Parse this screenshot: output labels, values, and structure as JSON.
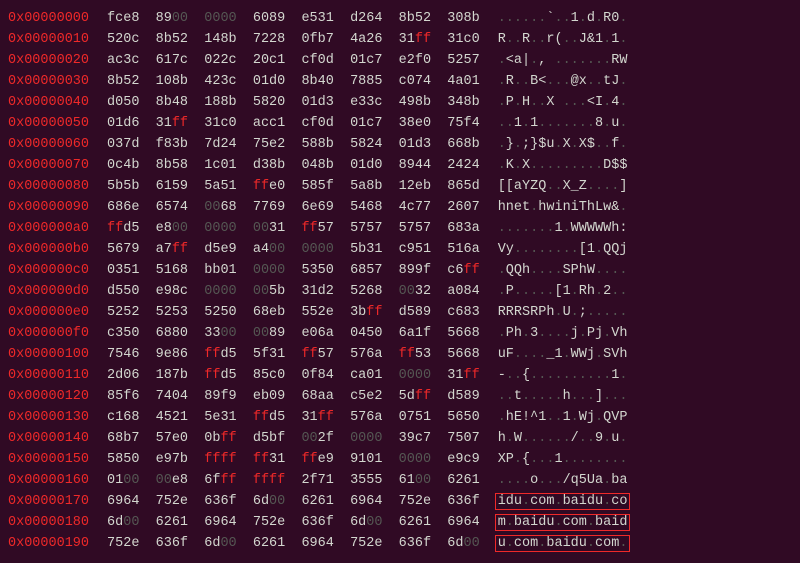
{
  "rows": [
    {
      "addr": "0x00000000",
      "hex": [
        "fce8",
        "8900",
        "0000",
        "6089",
        "e531",
        "d264",
        "8b52",
        "308b"
      ],
      "ascii": "......`..1.d.R0."
    },
    {
      "addr": "0x00000010",
      "hex": [
        "520c",
        "8b52",
        "148b",
        "7228",
        "0fb7",
        "4a26",
        "31ff",
        "31c0"
      ],
      "ascii": "R..R..r(..J&1.1."
    },
    {
      "addr": "0x00000020",
      "hex": [
        "ac3c",
        "617c",
        "022c",
        "20c1",
        "cf0d",
        "01c7",
        "e2f0",
        "5257"
      ],
      "ascii": ".<a|., .......RW"
    },
    {
      "addr": "0x00000030",
      "hex": [
        "8b52",
        "108b",
        "423c",
        "01d0",
        "8b40",
        "7885",
        "c074",
        "4a01"
      ],
      "ascii": ".R..B<...@x..tJ."
    },
    {
      "addr": "0x00000040",
      "hex": [
        "d050",
        "8b48",
        "188b",
        "5820",
        "01d3",
        "e33c",
        "498b",
        "348b"
      ],
      "ascii": ".P.H..X ...<I.4."
    },
    {
      "addr": "0x00000050",
      "hex": [
        "01d6",
        "31ff",
        "31c0",
        "acc1",
        "cf0d",
        "01c7",
        "38e0",
        "75f4"
      ],
      "ascii": "..1.1.......8.u."
    },
    {
      "addr": "0x00000060",
      "hex": [
        "037d",
        "f83b",
        "7d24",
        "75e2",
        "588b",
        "5824",
        "01d3",
        "668b"
      ],
      "ascii": ".}.;}$u.X.X$..f."
    },
    {
      "addr": "0x00000070",
      "hex": [
        "0c4b",
        "8b58",
        "1c01",
        "d38b",
        "048b",
        "01d0",
        "8944",
        "2424"
      ],
      "ascii": ".K.X.........D$$"
    },
    {
      "addr": "0x00000080",
      "hex": [
        "5b5b",
        "6159",
        "5a51",
        "ffe0",
        "585f",
        "5a8b",
        "12eb",
        "865d"
      ],
      "ascii": "[[aYZQ..X_Z....]"
    },
    {
      "addr": "0x00000090",
      "hex": [
        "686e",
        "6574",
        "0068",
        "7769",
        "6e69",
        "5468",
        "4c77",
        "2607"
      ],
      "ascii": "hnet.hwiniThLw&."
    },
    {
      "addr": "0x000000a0",
      "hex": [
        "ffd5",
        "e800",
        "0000",
        "0031",
        "ff57",
        "5757",
        "5757",
        "683a"
      ],
      "ascii": ".......1.WWWWWh:"
    },
    {
      "addr": "0x000000b0",
      "hex": [
        "5679",
        "a7ff",
        "d5e9",
        "a400",
        "0000",
        "5b31",
        "c951",
        "516a"
      ],
      "ascii": "Vy........[1.QQj"
    },
    {
      "addr": "0x000000c0",
      "hex": [
        "0351",
        "5168",
        "bb01",
        "0000",
        "5350",
        "6857",
        "899f",
        "c6ff"
      ],
      "ascii": ".QQh....SPhW...."
    },
    {
      "addr": "0x000000d0",
      "hex": [
        "d550",
        "e98c",
        "0000",
        "005b",
        "31d2",
        "5268",
        "0032",
        "a084"
      ],
      "ascii": ".P.....[1.Rh.2.."
    },
    {
      "addr": "0x000000e0",
      "hex": [
        "5252",
        "5253",
        "5250",
        "68eb",
        "552e",
        "3bff",
        "d589",
        "c683"
      ],
      "ascii": "RRRSRPh.U.;....."
    },
    {
      "addr": "0x000000f0",
      "hex": [
        "c350",
        "6880",
        "3300",
        "0089",
        "e06a",
        "0450",
        "6a1f",
        "5668"
      ],
      "ascii": ".Ph.3....j.Pj.Vh"
    },
    {
      "addr": "0x00000100",
      "hex": [
        "7546",
        "9e86",
        "ffd5",
        "5f31",
        "ff57",
        "576a",
        "ff53",
        "5668"
      ],
      "ascii": "uF...._1.WWj.SVh"
    },
    {
      "addr": "0x00000110",
      "hex": [
        "2d06",
        "187b",
        "ffd5",
        "85c0",
        "0f84",
        "ca01",
        "0000",
        "31ff"
      ],
      "ascii": "-..{..........1."
    },
    {
      "addr": "0x00000120",
      "hex": [
        "85f6",
        "7404",
        "89f9",
        "eb09",
        "68aa",
        "c5e2",
        "5dff",
        "d589"
      ],
      "ascii": "..t.....h...]..."
    },
    {
      "addr": "0x00000130",
      "hex": [
        "c168",
        "4521",
        "5e31",
        "ffd5",
        "31ff",
        "576a",
        "0751",
        "5650"
      ],
      "ascii": ".hE!^1..1.Wj.QVP"
    },
    {
      "addr": "0x00000140",
      "hex": [
        "68b7",
        "57e0",
        "0bff",
        "d5bf",
        "002f",
        "0000",
        "39c7",
        "7507"
      ],
      "ascii": "h.W....../..9.u."
    },
    {
      "addr": "0x00000150",
      "hex": [
        "5850",
        "e97b",
        "ffff",
        "ff31",
        "ffe9",
        "9101",
        "0000",
        "e9c9"
      ],
      "ascii": "XP.{...1........"
    },
    {
      "addr": "0x00000160",
      "hex": [
        "0100",
        "00e8",
        "6fff",
        "ffff",
        "2f71",
        "3555",
        "6100",
        "6261"
      ],
      "ascii": "....o.../q5Ua.ba"
    },
    {
      "addr": "0x00000170",
      "hex": [
        "6964",
        "752e",
        "636f",
        "6d00",
        "6261",
        "6964",
        "752e",
        "636f"
      ],
      "ascii": "idu.com.baidu.co",
      "boxed": true
    },
    {
      "addr": "0x00000180",
      "hex": [
        "6d00",
        "6261",
        "6964",
        "752e",
        "636f",
        "6d00",
        "6261",
        "6964"
      ],
      "ascii": "m.baidu.com.baid",
      "boxed": true
    },
    {
      "addr": "0x00000190",
      "hex": [
        "752e",
        "636f",
        "6d00",
        "6261",
        "6964",
        "752e",
        "636f",
        "6d00"
      ],
      "ascii": "u.com.baidu.com.",
      "boxed": true
    }
  ]
}
